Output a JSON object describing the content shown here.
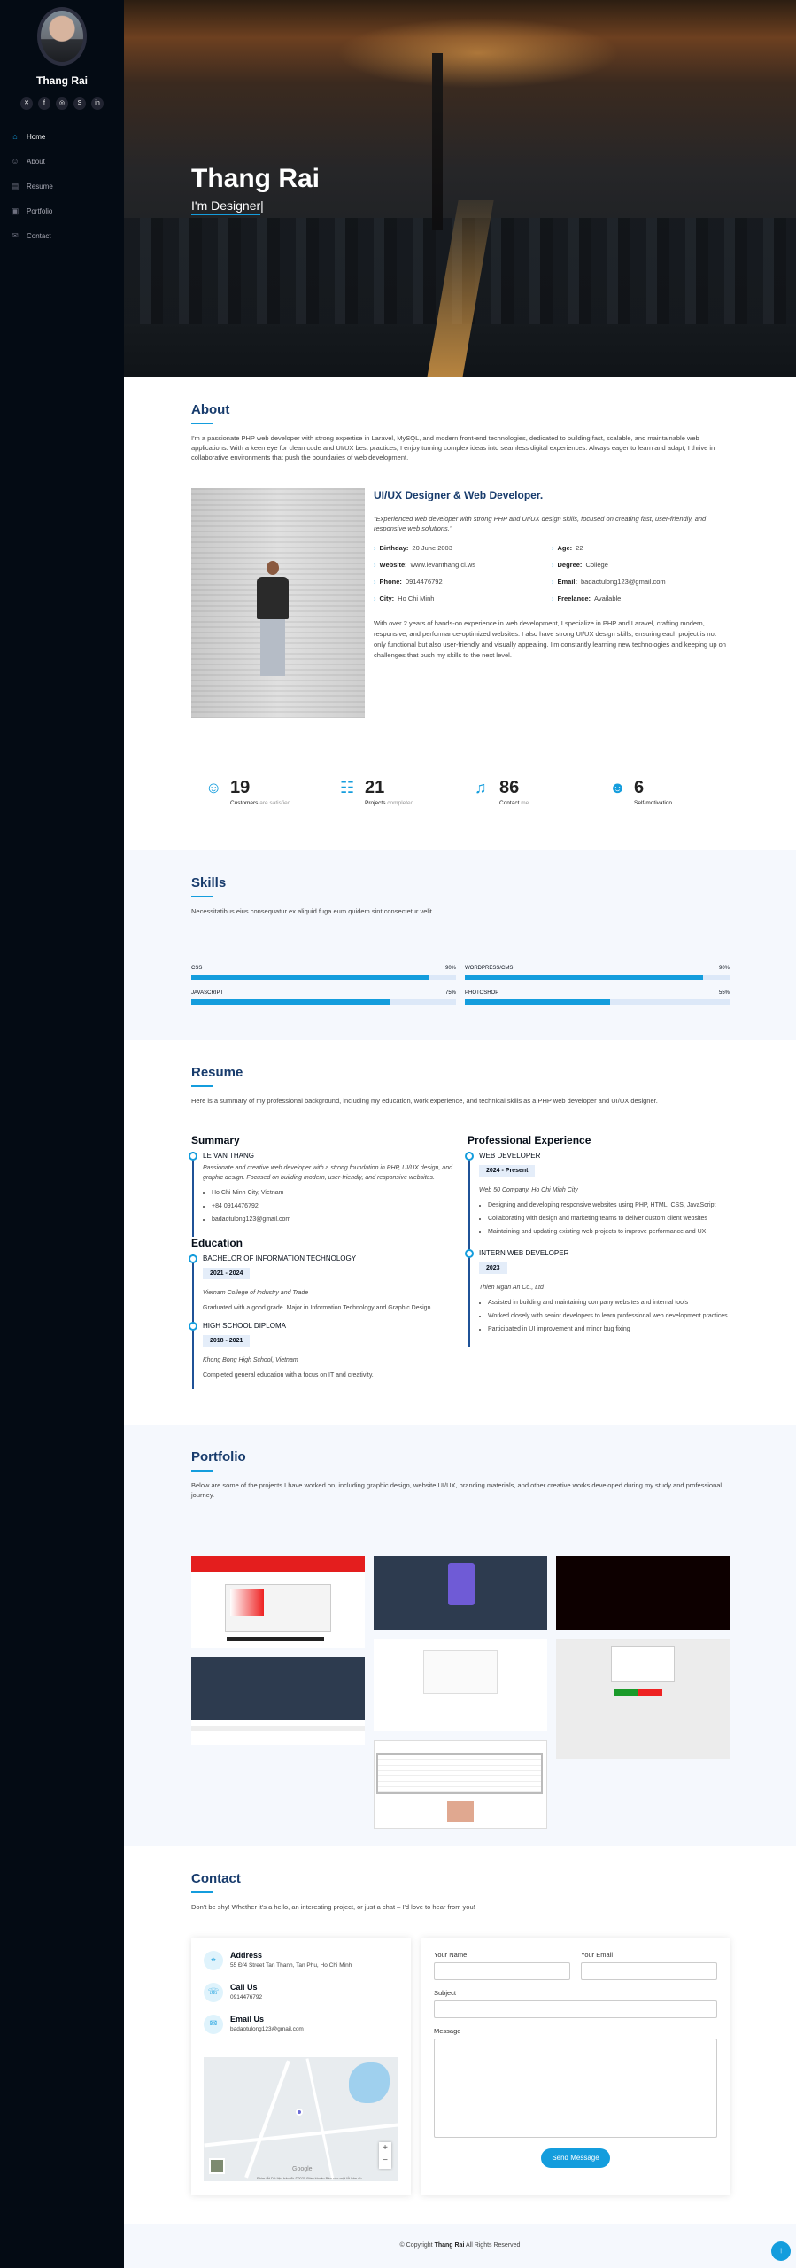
{
  "sidebar": {
    "name": "Thang Rai",
    "socials": [
      "twitter-icon",
      "facebook-icon",
      "instagram-icon",
      "skype-icon",
      "linkedin-icon"
    ],
    "nav": [
      {
        "label": "Home",
        "icon": "home-icon",
        "active": true
      },
      {
        "label": "About",
        "icon": "person-icon",
        "active": false
      },
      {
        "label": "Resume",
        "icon": "file-icon",
        "active": false
      },
      {
        "label": "Portfolio",
        "icon": "images-icon",
        "active": false
      },
      {
        "label": "Contact",
        "icon": "envelope-icon",
        "active": false
      }
    ]
  },
  "hero": {
    "name": "Thang Rai",
    "prefix": "I'm ",
    "typed": "Designer",
    "cursor": "|"
  },
  "about": {
    "title": "About",
    "desc": "I'm a passionate PHP web developer with strong expertise in Laravel, MySQL, and modern front-end technologies, dedicated to building fast, scalable, and maintainable web applications. With a keen eye for clean code and UI/UX best practices, I enjoy turning complex ideas into seamless digital experiences. Always eager to learn and adapt, I thrive in collaborative environments that push the boundaries of web development.",
    "heading": "UI/UX Designer & Web Developer.",
    "quote": "\"Experienced web developer with strong PHP and UI/UX design skills, focused on creating fast, user-friendly, and responsive web solutions.\"",
    "info": [
      {
        "label": "Birthday:",
        "value": "20 June 2003"
      },
      {
        "label": "Age:",
        "value": "22"
      },
      {
        "label": "Website:",
        "value": "www.levanthang.cl.ws"
      },
      {
        "label": "Degree:",
        "value": "College"
      },
      {
        "label": "Phone:",
        "value": "0914476792"
      },
      {
        "label": "Email:",
        "value": "badaotulong123@gmail.com"
      },
      {
        "label": "City:",
        "value": "Ho Chi Minh"
      },
      {
        "label": "Freelance:",
        "value": "Available"
      }
    ],
    "long": "With over 2 years of hands-on experience in web development, I specialize in PHP and Laravel, crafting modern, responsive, and performance-optimized websites. I also have strong UI/UX design skills, ensuring each project is not only functional but also user-friendly and visually appealing. I'm constantly learning new technologies and keeping up on challenges that push my skills to the next level."
  },
  "stats": [
    {
      "icon": "smile-icon",
      "num": "19",
      "label": "Customers",
      "muted": "are satisfied"
    },
    {
      "icon": "journal-icon",
      "num": "21",
      "label": "Projects",
      "muted": "completed"
    },
    {
      "icon": "headset-icon",
      "num": "86",
      "label": "Contact",
      "muted": "me"
    },
    {
      "icon": "people-icon",
      "num": "6",
      "label": "Self-motivation",
      "muted": ""
    }
  ],
  "skills": {
    "title": "Skills",
    "desc": "Necessitatibus eius consequatur ex aliquid fuga eum quidem sint consectetur velit",
    "items": [
      {
        "name": "CSS",
        "pct": "90%",
        "value": 90
      },
      {
        "name": "WORDPRESS/CMS",
        "pct": "90%",
        "value": 90
      },
      {
        "name": "JAVASCRIPT",
        "pct": "75%",
        "value": 75
      },
      {
        "name": "PHOTOSHOP",
        "pct": "55%",
        "value": 55
      }
    ]
  },
  "resume": {
    "title": "Resume",
    "desc": "Here is a summary of my professional background, including my education, work experience, and technical skills as a PHP web developer and UI/UX designer.",
    "summary_title": "Summary",
    "summary": {
      "name": "LE VAN THANG",
      "text": "Passionate and creative web developer with a strong foundation in PHP, UI/UX design, and graphic design. Focused on building modern, user-friendly, and responsive websites.",
      "contacts": [
        "Ho Chi Minh City, Vietnam",
        "+84 0914476792",
        "badaotulong123@gmail.com"
      ]
    },
    "education_title": "Education",
    "education": [
      {
        "title": "BACHELOR OF INFORMATION TECHNOLOGY",
        "date": "2021 - 2024",
        "place": "Vietnam College of Industry and Trade",
        "text": "Graduated with a good grade. Major in Information Technology and Graphic Design."
      },
      {
        "title": "HIGH SCHOOL DIPLOMA",
        "date": "2018 - 2021",
        "place": "Khong Bong High School, Vietnam",
        "text": "Completed general education with a focus on IT and creativity."
      }
    ],
    "experience_title": "Professional Experience",
    "experience": [
      {
        "title": "WEB DEVELOPER",
        "date": "2024 - Present",
        "place": "Web 50 Company, Ho Chi Minh City",
        "bullets": [
          "Designing and developing responsive websites using PHP, HTML, CSS, JavaScript",
          "Collaborating with design and marketing teams to deliver custom client websites",
          "Maintaining and updating existing web projects to improve performance and UX"
        ]
      },
      {
        "title": "INTERN WEB DEVELOPER",
        "date": "2023",
        "place": "Thien Ngan An Co., Ltd",
        "bullets": [
          "Assisted in building and maintaining company websites and internal tools",
          "Worked closely with senior developers to learn professional web development practices",
          "Participated in UI improvement and minor bug fixing"
        ]
      }
    ]
  },
  "portfolio": {
    "title": "Portfolio",
    "desc": "Below are some of the projects I have worked on, including graphic design, website UI/UX, branding materials, and other creative works developed during my study and professional journey."
  },
  "contact": {
    "title": "Contact",
    "desc": "Don't be shy! Whether it's a hello, an interesting project, or just a chat – I'd love to hear from you!",
    "address_title": "Address",
    "address": "55 Đ/4 Street Tan Thanh, Tan Phu, Ho Chi Minh",
    "call_title": "Call Us",
    "phone": "0914476792",
    "email_title": "Email Us",
    "email": "badaotulong123@gmail.com",
    "map_label": "Google",
    "map_credit": "Phím tắt   Dữ liệu bản đồ ©2025   Điều khoản   Báo cáo một lỗi bản đồ",
    "name_label": "Your Name",
    "email_label": "Your Email",
    "subject_label": "Subject",
    "message_label": "Message",
    "send_label": "Send Message"
  },
  "footer": {
    "prefix": "© Copyright ",
    "name": "Thang Rai",
    "suffix": " All Rights Reserved"
  }
}
